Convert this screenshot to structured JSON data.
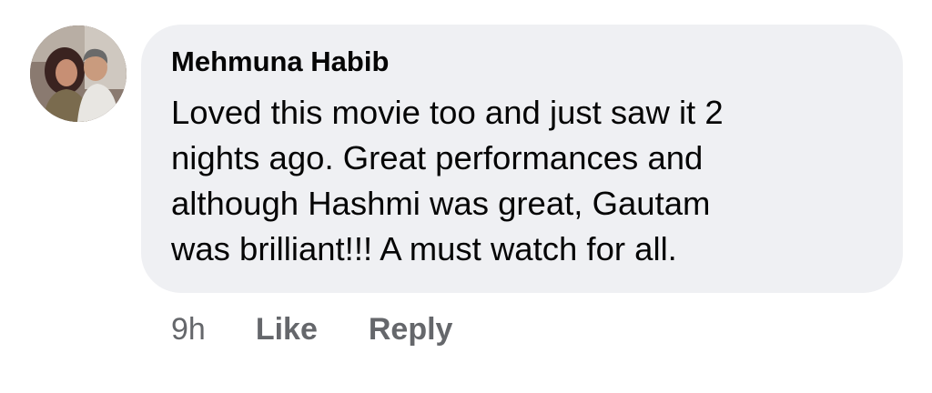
{
  "comment": {
    "author": "Mehmuna Habib",
    "avatar_icon": "profile-photo-avatar",
    "text_lines": [
      "Loved this movie too and just saw it 2",
      "nights ago. Great performances and",
      "although Hashmi was great, Gautam",
      "was brilliant!!! A must watch for all."
    ],
    "timestamp": "9h",
    "like_label": "Like",
    "reply_label": "Reply"
  },
  "colors": {
    "bubble_background": "#eff0f3",
    "text": "#050505",
    "secondary_text": "#65676b"
  }
}
